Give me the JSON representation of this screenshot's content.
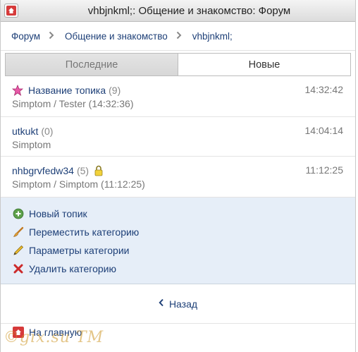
{
  "header": {
    "title": "vhbjnkml;: Общение и знакомство: Форум"
  },
  "breadcrumb": [
    {
      "label": "Форум"
    },
    {
      "label": "Общение и знакомство"
    },
    {
      "label": "vhbjnkml;"
    }
  ],
  "tabs": [
    {
      "label": "Последние",
      "active": false
    },
    {
      "label": "Новые",
      "active": true
    }
  ],
  "topics": [
    {
      "name": "Название топика",
      "count": "(9)",
      "author": "Simptom / Tester (14:32:36)",
      "time": "14:32:42",
      "icon": "star-icon",
      "locked": false
    },
    {
      "name": "utkukt",
      "count": "(0)",
      "author": "Simptom",
      "time": "14:04:14",
      "icon": "",
      "locked": false
    },
    {
      "name": "nhbgrvfedw34",
      "count": "(5)",
      "author": "Simptom / Simptom (11:12:25)",
      "time": "11:12:25",
      "icon": "",
      "locked": true
    }
  ],
  "actions": [
    {
      "label": "Новый топик",
      "icon": "plus-icon"
    },
    {
      "label": "Переместить категорию",
      "icon": "brush-icon"
    },
    {
      "label": "Параметры категории",
      "icon": "pencil-icon"
    },
    {
      "label": "Удалить категорию",
      "icon": "delete-icon"
    }
  ],
  "back_label": "Назад",
  "home_label": "На главную",
  "watermark": "©gix.su TM",
  "colors": {
    "link": "#1d3f77",
    "action_bg": "#e6eef8",
    "home_red": "#d63a3a"
  }
}
